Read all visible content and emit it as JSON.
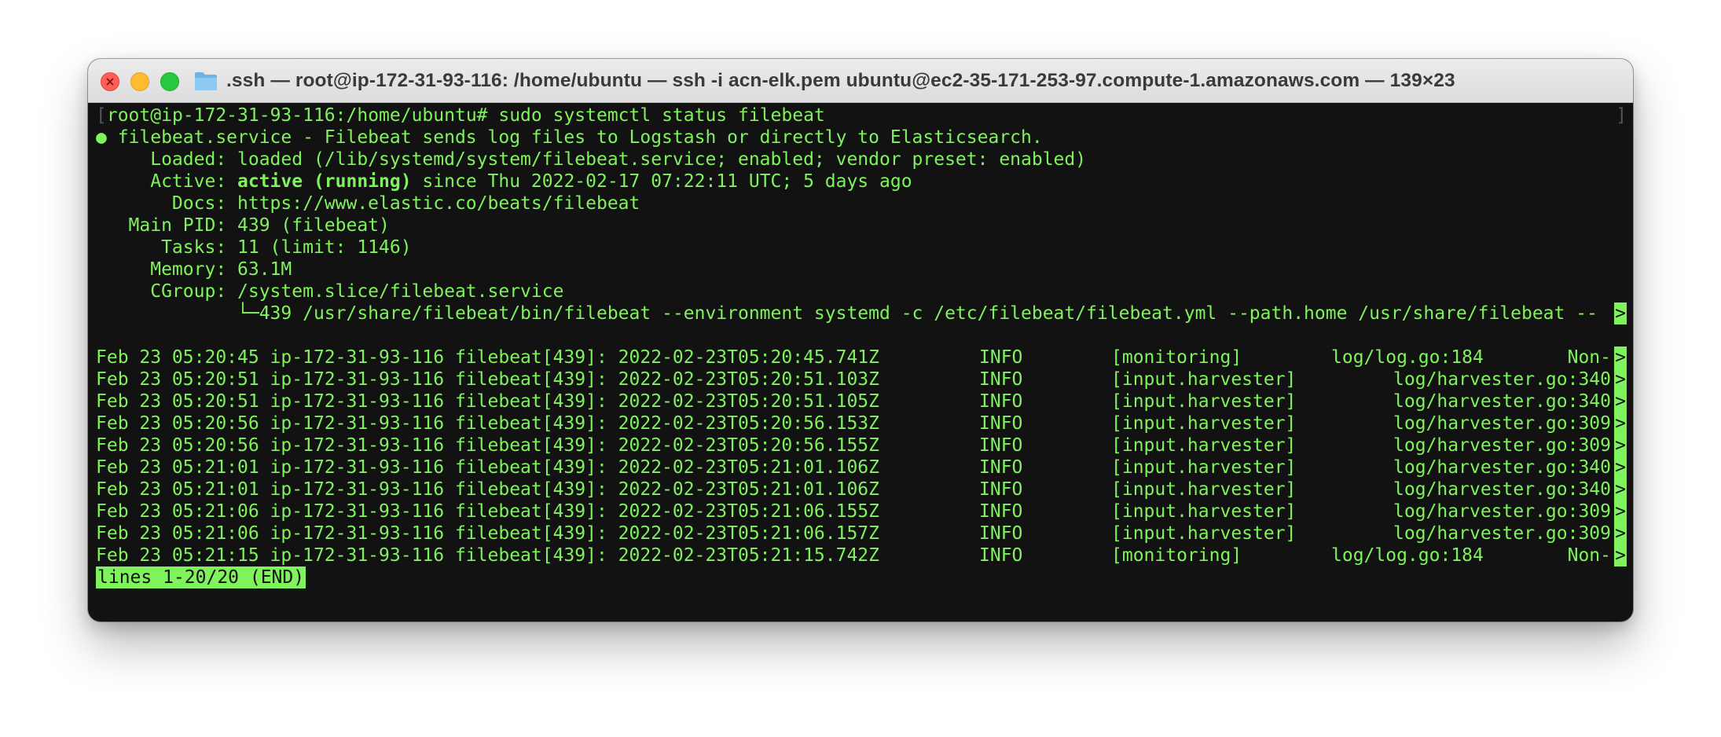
{
  "window": {
    "title": ".ssh — root@ip-172-31-93-116: /home/ubuntu — ssh -i acn-elk.pem ubuntu@ec2-35-171-253-97.compute-1.amazonaws.com — 139×23",
    "folder_icon": "folder-icon"
  },
  "terminal": {
    "prompt_line": "root@ip-172-31-93-116:/home/ubuntu# sudo systemctl status filebeat",
    "service_line": "● filebeat.service - Filebeat sends log files to Logstash or directly to Elasticsearch.",
    "loaded": "     Loaded: loaded (/lib/systemd/system/filebeat.service; enabled; vendor preset: enabled)",
    "active_label": "     Active: ",
    "active_state": "active (running)",
    "active_rest": " since Thu 2022-02-17 07:22:11 UTC; 5 days ago",
    "docs": "       Docs: https://www.elastic.co/beats/filebeat",
    "main_pid": "   Main PID: 439 (filebeat)",
    "tasks": "      Tasks: 11 (limit: 1146)",
    "memory": "     Memory: 63.1M",
    "cgroup": "     CGroup: /system.slice/filebeat.service",
    "cgroup_process": "             └─439 /usr/share/filebeat/bin/filebeat --environment systemd -c /etc/filebeat/filebeat.yml --path.home /usr/share/filebeat --",
    "truncation_marker": ">",
    "log_rows": [
      {
        "prefix": "Feb 23 05:20:45 ip-172-31-93-116 filebeat[439]: 2022-02-23T05:20:45.741Z",
        "level": "INFO",
        "component": "[monitoring]",
        "source": "log/log.go:184",
        "tail": "Non-"
      },
      {
        "prefix": "Feb 23 05:20:51 ip-172-31-93-116 filebeat[439]: 2022-02-23T05:20:51.103Z",
        "level": "INFO",
        "component": "[input.harvester]",
        "source": "log/harvester.go:340",
        "tail": ""
      },
      {
        "prefix": "Feb 23 05:20:51 ip-172-31-93-116 filebeat[439]: 2022-02-23T05:20:51.105Z",
        "level": "INFO",
        "component": "[input.harvester]",
        "source": "log/harvester.go:340",
        "tail": ""
      },
      {
        "prefix": "Feb 23 05:20:56 ip-172-31-93-116 filebeat[439]: 2022-02-23T05:20:56.153Z",
        "level": "INFO",
        "component": "[input.harvester]",
        "source": "log/harvester.go:309",
        "tail": ""
      },
      {
        "prefix": "Feb 23 05:20:56 ip-172-31-93-116 filebeat[439]: 2022-02-23T05:20:56.155Z",
        "level": "INFO",
        "component": "[input.harvester]",
        "source": "log/harvester.go:309",
        "tail": ""
      },
      {
        "prefix": "Feb 23 05:21:01 ip-172-31-93-116 filebeat[439]: 2022-02-23T05:21:01.106Z",
        "level": "INFO",
        "component": "[input.harvester]",
        "source": "log/harvester.go:340",
        "tail": ""
      },
      {
        "prefix": "Feb 23 05:21:01 ip-172-31-93-116 filebeat[439]: 2022-02-23T05:21:01.106Z",
        "level": "INFO",
        "component": "[input.harvester]",
        "source": "log/harvester.go:340",
        "tail": ""
      },
      {
        "prefix": "Feb 23 05:21:06 ip-172-31-93-116 filebeat[439]: 2022-02-23T05:21:06.155Z",
        "level": "INFO",
        "component": "[input.harvester]",
        "source": "log/harvester.go:309",
        "tail": ""
      },
      {
        "prefix": "Feb 23 05:21:06 ip-172-31-93-116 filebeat[439]: 2022-02-23T05:21:06.157Z",
        "level": "INFO",
        "component": "[input.harvester]",
        "source": "log/harvester.go:309",
        "tail": ""
      },
      {
        "prefix": "Feb 23 05:21:15 ip-172-31-93-116 filebeat[439]: 2022-02-23T05:21:15.742Z",
        "level": "INFO",
        "component": "[monitoring]",
        "source": "log/log.go:184",
        "tail": "Non-"
      }
    ],
    "pager_status": "lines 1-20/20 (END)"
  },
  "colors": {
    "terminal_fg": "#7ef35c",
    "terminal_bg": "#121212",
    "close": "#ff5f57",
    "minimize": "#febc2e",
    "maximize": "#28c840"
  }
}
